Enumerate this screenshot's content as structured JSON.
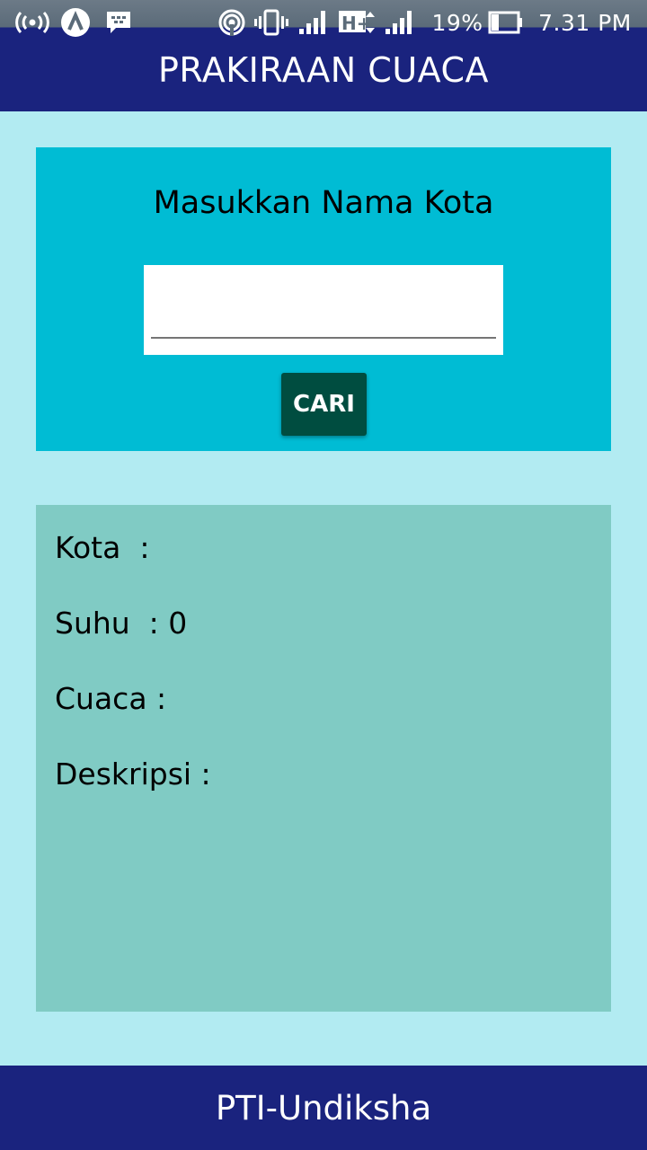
{
  "status_bar": {
    "battery": "19%",
    "time": "7.31 PM",
    "icons": [
      "wifi-hotspot-icon",
      "app-logo-icon",
      "bbm-icon",
      "hotspot-icon",
      "vibrate-icon",
      "signal-icon",
      "hplus-data-icon",
      "signal-icon-2",
      "battery-icon"
    ]
  },
  "app_bar": {
    "title": "PRAKIRAAN CUACA",
    "color": "#1a237e"
  },
  "search": {
    "prompt": "Masukkan Nama Kota",
    "input_value": "",
    "button_label": "CARI",
    "card_color": "#00bcd4",
    "button_color": "#004d40"
  },
  "result": {
    "card_color": "#80cbc4",
    "kota": "Kota  :",
    "suhu": "Suhu  : 0",
    "cuaca": "Cuaca :",
    "deskripsi": "Deskripsi :"
  },
  "footer": {
    "text": "PTI-Undiksha"
  }
}
